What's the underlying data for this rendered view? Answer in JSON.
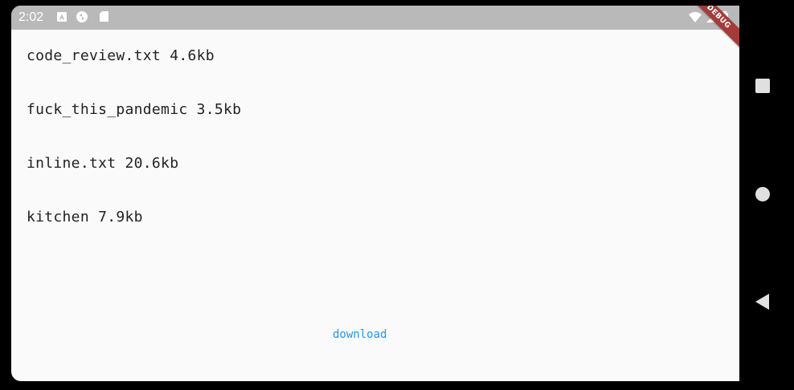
{
  "status_bar": {
    "time": "2:02",
    "debug_banner": "DEBUG"
  },
  "files": [
    {
      "label": "code_review.txt 4.6kb"
    },
    {
      "label": "fuck_this_pandemic 3.5kb"
    },
    {
      "label": "inline.txt 20.6kb"
    },
    {
      "label": "kitchen 7.9kb"
    }
  ],
  "download_label": "download",
  "colors": {
    "accent": "#2196f3",
    "status_bar": "#b9b9b9",
    "debug_banner": "#a43b3b"
  }
}
